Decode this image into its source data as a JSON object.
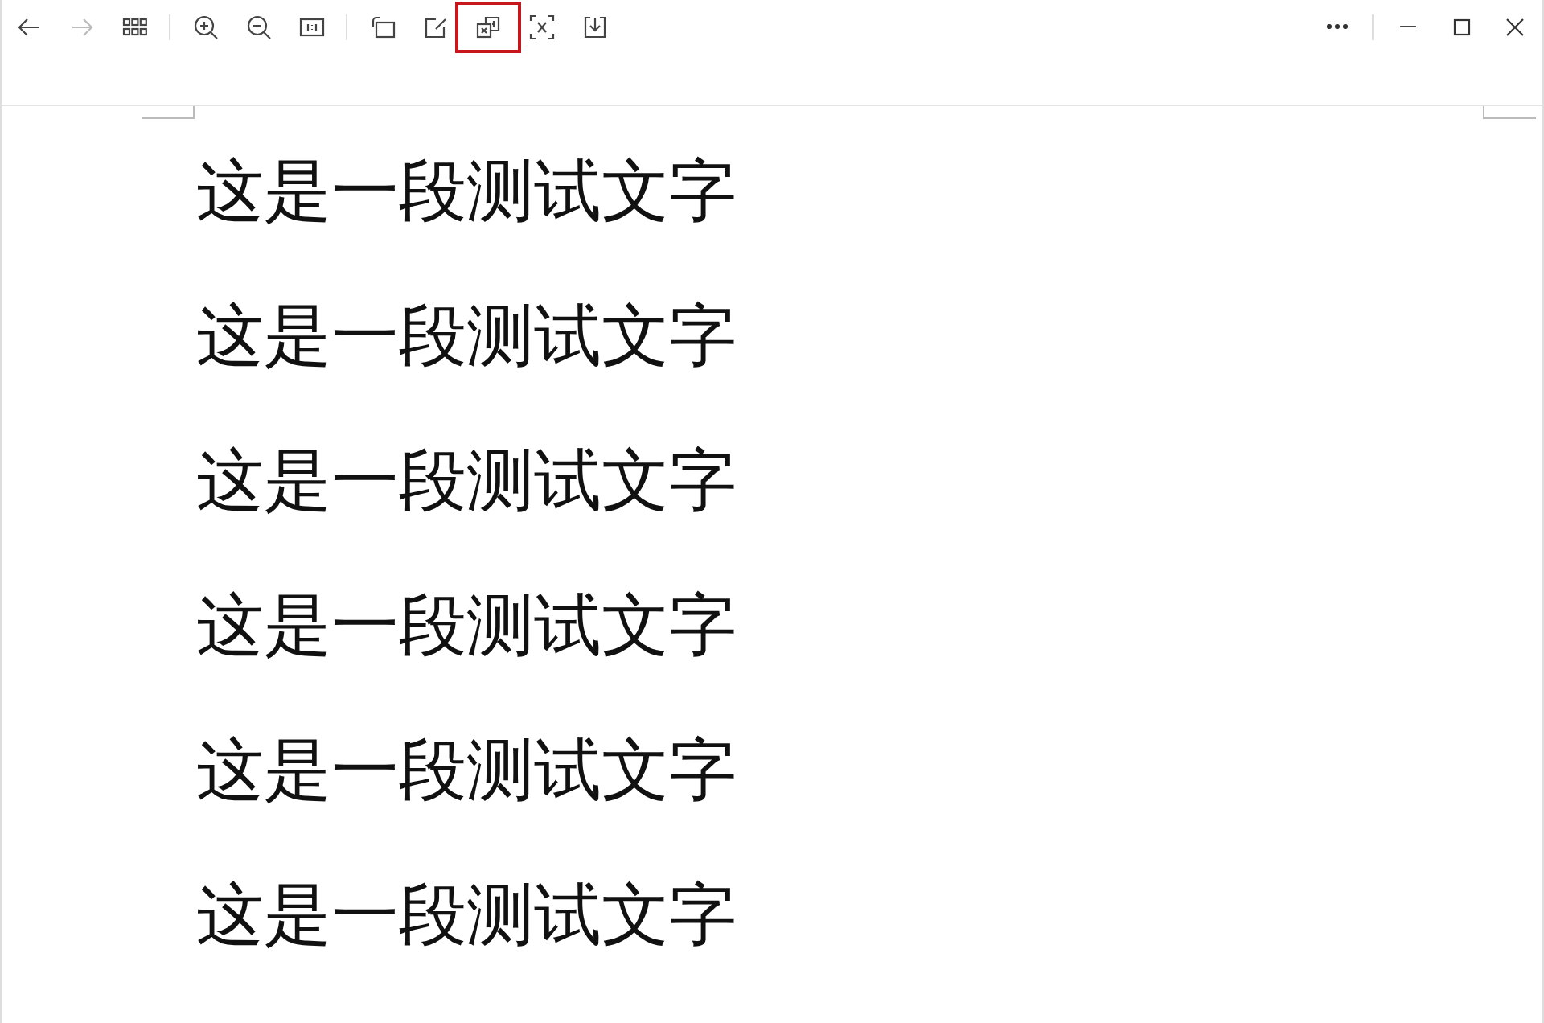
{
  "toolbar": {
    "tools": [
      {
        "kind": "back",
        "disabled": false,
        "highlighted": false
      },
      {
        "kind": "forward",
        "disabled": true,
        "highlighted": false
      },
      {
        "kind": "grid",
        "disabled": false,
        "highlighted": false
      },
      {
        "kind": "separator"
      },
      {
        "kind": "zoom-in",
        "disabled": false,
        "highlighted": false
      },
      {
        "kind": "zoom-out",
        "disabled": false,
        "highlighted": false
      },
      {
        "kind": "actual-size",
        "disabled": false,
        "highlighted": false
      },
      {
        "kind": "separator"
      },
      {
        "kind": "rotate",
        "disabled": false,
        "highlighted": false
      },
      {
        "kind": "edit",
        "disabled": false,
        "highlighted": false
      },
      {
        "kind": "translate",
        "disabled": false,
        "highlighted": true
      },
      {
        "kind": "text-select",
        "disabled": false,
        "highlighted": false
      },
      {
        "kind": "save",
        "disabled": false,
        "highlighted": false
      }
    ],
    "window_controls": [
      {
        "kind": "more"
      },
      {
        "kind": "separator"
      },
      {
        "kind": "minimize"
      },
      {
        "kind": "maximize"
      },
      {
        "kind": "close"
      }
    ]
  },
  "document": {
    "lines": [
      "这是一段测试文字",
      "这是一段测试文字",
      "这是一段测试文字",
      "这是一段测试文字",
      "这是一段测试文字",
      "这是一段测试文字"
    ]
  }
}
